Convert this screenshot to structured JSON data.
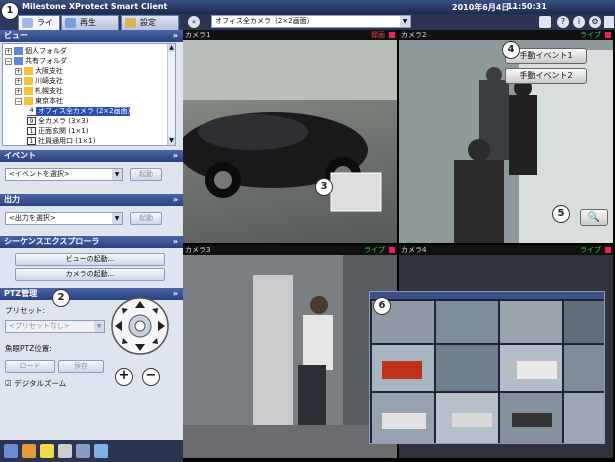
{
  "window": {
    "title": "Milestone XProtect Smart Client",
    "date": "2010年6月4日 -",
    "time": "11:50:31"
  },
  "tabs": [
    {
      "label": "ライブ"
    },
    {
      "label": "再生"
    },
    {
      "label": "設定"
    }
  ],
  "callouts": [
    "1",
    "2",
    "3",
    "4",
    "5",
    "6"
  ],
  "view_section": {
    "title": "ビュー",
    "tree": [
      {
        "label": "個人フォルダ",
        "level": 1
      },
      {
        "label": "共有フォルダ",
        "level": 1
      },
      {
        "label": "大阪支社",
        "level": 2
      },
      {
        "label": "川崎支社",
        "level": 2
      },
      {
        "label": "札幌支社",
        "level": 2
      },
      {
        "label": "東京本社",
        "level": 2
      },
      {
        "label": "オフィス全カメラ (2×2画面)",
        "level": 3,
        "num": "4",
        "selected": true
      },
      {
        "label": "全カメラ (3×3)",
        "level": 3,
        "num": "9"
      },
      {
        "label": "正面玄関 (1×1)",
        "level": 3,
        "num": "1"
      },
      {
        "label": "社員通用口 (1×1)",
        "level": 3,
        "num": "1"
      }
    ]
  },
  "event_section": {
    "title": "イベント",
    "select": "<イベントを選択>",
    "button": "起動"
  },
  "output_section": {
    "title": "出力",
    "select": "<出力を選択>",
    "button": "起動"
  },
  "sequence_section": {
    "title": "シーケンスエクスプローラ",
    "view_button": "ビューの起動...",
    "camera_button": "カメラの起動..."
  },
  "ptz_section": {
    "title": "PTZ管理",
    "preset_label": "プリセット:",
    "preset_value": "<プリセットなし>",
    "preset_button": "起動",
    "fisheye_label": "魚眼PTZ位置:",
    "load_button": "ロード",
    "save_button": "保存",
    "digital_zoom_label": "デジタルズーム",
    "zoom_in": "+",
    "zoom_out": "−"
  },
  "toolbar": {
    "view_select": "オフィス全カメラ（2×2画面）"
  },
  "cameras": [
    {
      "name": "カメラ1",
      "status": "録画"
    },
    {
      "name": "カメラ2",
      "status": "ライブ"
    },
    {
      "name": "カメラ3",
      "status": "ライブ"
    },
    {
      "name": "カメラ4",
      "status": "ライブ"
    }
  ],
  "events": {
    "button1": "手動イベント1",
    "button2": "手動イベント2"
  },
  "colors": {
    "section_header": "#2b427e",
    "selected": "#2a4fb0",
    "live": "#35d04a",
    "rec": "#e43"
  }
}
